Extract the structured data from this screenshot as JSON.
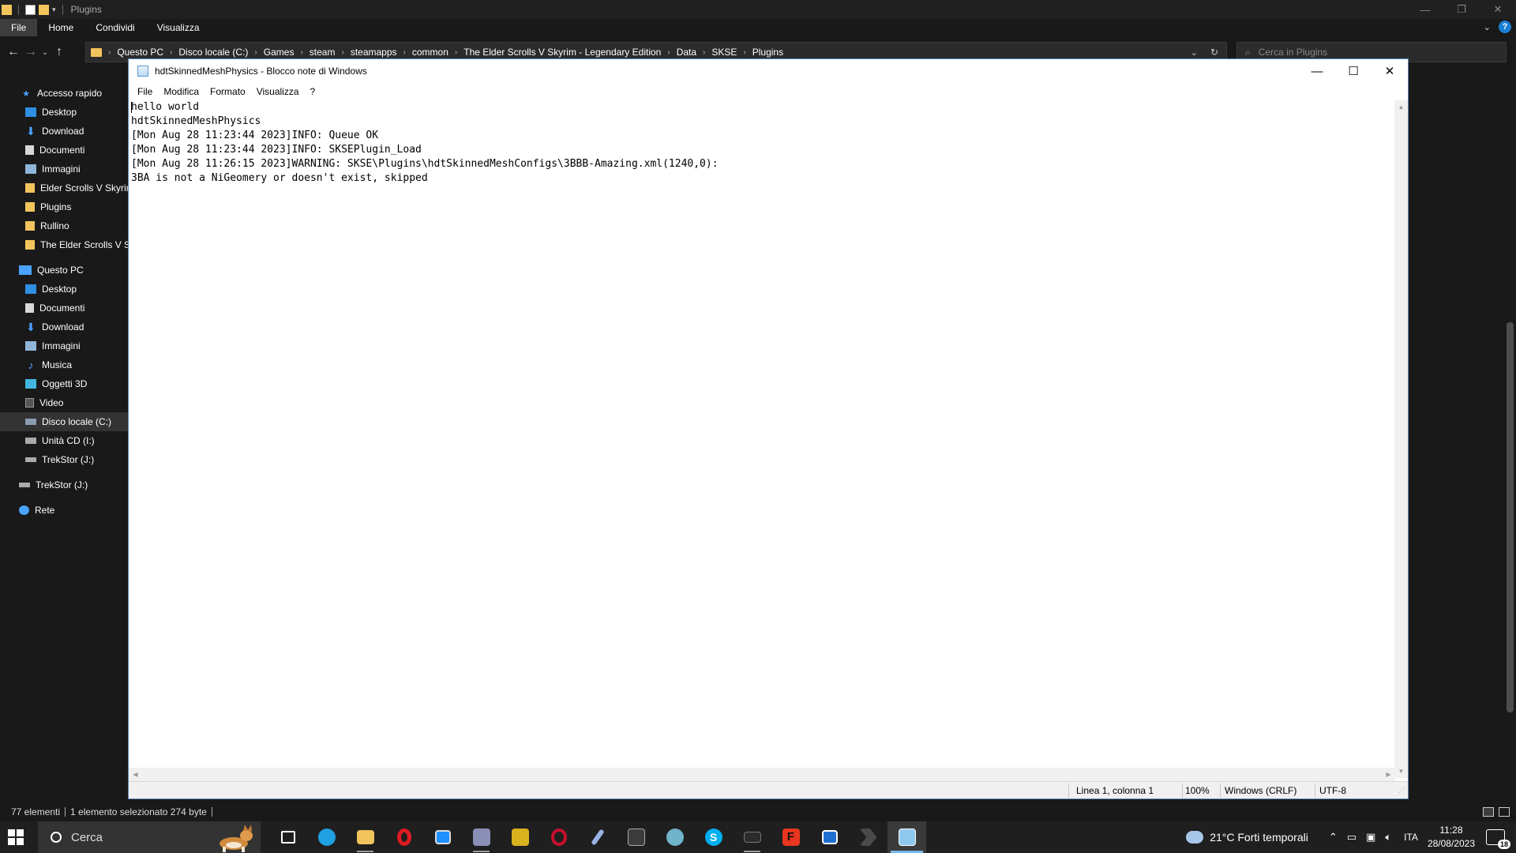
{
  "explorer": {
    "title": "Plugins",
    "ribbon_tabs": [
      "File",
      "Home",
      "Condividi",
      "Visualizza"
    ],
    "breadcrumbs": [
      "Questo PC",
      "Disco locale (C:)",
      "Games",
      "steam",
      "steamapps",
      "common",
      "The Elder Scrolls V Skyrim - Legendary Edition",
      "Data",
      "SKSE",
      "Plugins"
    ],
    "search_placeholder": "Cerca in Plugins",
    "nav": {
      "quick_access": "Accesso rapido",
      "quick_items": [
        "Desktop",
        "Download",
        "Documenti",
        "Immagini",
        "Elder Scrolls V  Skyrim",
        "Plugins",
        "Rullino",
        "The Elder Scrolls V Skyrim"
      ],
      "this_pc": "Questo PC",
      "pc_items": [
        "Desktop",
        "Documenti",
        "Download",
        "Immagini",
        "Musica",
        "Oggetti 3D",
        "Video",
        "Disco locale (C:)",
        "Unità CD (I:)",
        "TrekStor (J:)"
      ],
      "trekstor": "TrekStor (J:)",
      "network": "Rete"
    },
    "status": {
      "count": "77 elementi",
      "selection": "1 elemento selezionato  274 byte"
    }
  },
  "notepad": {
    "title": "hdtSkinnedMeshPhysics - Blocco note di Windows",
    "menu": [
      "File",
      "Modifica",
      "Formato",
      "Visualizza",
      "?"
    ],
    "lines": [
      "hello world",
      "hdtSkinnedMeshPhysics",
      "[Mon Aug 28 11:23:44 2023]INFO: Queue OK",
      "[Mon Aug 28 11:23:44 2023]INFO: SKSEPlugin_Load",
      "[Mon Aug 28 11:26:15 2023]WARNING: SKSE\\Plugins\\hdtSkinnedMeshConfigs\\3BBB-Amazing.xml(1240,0):",
      "3BA is not a NiGeomery or doesn't exist, skipped"
    ],
    "status": {
      "position": "Linea 1, colonna 1",
      "zoom": "100%",
      "line_ending": "Windows (CRLF)",
      "encoding": "UTF-8"
    }
  },
  "taskbar": {
    "search_label": "Cerca",
    "apps": [
      {
        "name": "task-view",
        "color": "#ffffff"
      },
      {
        "name": "edge",
        "color": "#1fa0e3"
      },
      {
        "name": "file-explorer",
        "color": "#f2c55c"
      },
      {
        "name": "opera",
        "color": "#e01b22"
      },
      {
        "name": "app-window",
        "color": "#1e90ff"
      },
      {
        "name": "media-app",
        "color": "#8a8fb6"
      },
      {
        "name": "yellow-app",
        "color": "#d9b21f"
      },
      {
        "name": "red-circle-app",
        "color": "#c8102e"
      },
      {
        "name": "pen-app",
        "color": "#9ab3e6"
      },
      {
        "name": "dark-app",
        "color": "#3b3b3b"
      },
      {
        "name": "paint-app",
        "color": "#6fb4c9"
      },
      {
        "name": "skype",
        "color": "#00aff0"
      },
      {
        "name": "terminal-app",
        "color": "#2b2b2b"
      },
      {
        "name": "red-f-app",
        "color": "#e8361f"
      },
      {
        "name": "blue-window-app",
        "color": "#1f6fd1"
      },
      {
        "name": "arrow-app",
        "color": "#4a4a4a"
      },
      {
        "name": "notepad",
        "color": "#8fc8ee"
      }
    ],
    "weather": "21°C  Forti temporali",
    "language": "ITA",
    "time": "11:28",
    "date": "28/08/2023",
    "notifications": "18"
  }
}
